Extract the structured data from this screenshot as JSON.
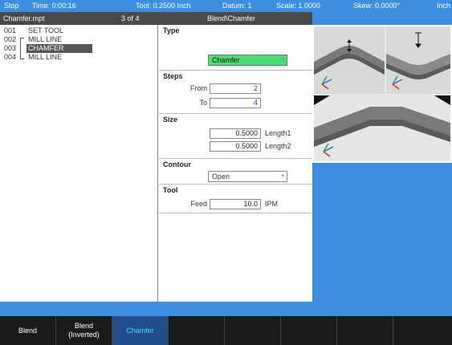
{
  "status_bar": {
    "mode": "Stop",
    "time": "Time: 0:00:16",
    "tool": "Tool: 0.2500 Inch",
    "datum": "Datum: 1",
    "scale": "Scale: 1.0000",
    "skew": "Skew: 0.0000°",
    "units": "Inch"
  },
  "title_bar": {
    "file": "Chamfer.mpt",
    "position": "3 of 4",
    "operation": "Blend\\Chamfer"
  },
  "program": {
    "rows": [
      {
        "num": "001",
        "name": "SET TOOL"
      },
      {
        "num": "002",
        "name": "MILL LINE"
      },
      {
        "num": "003",
        "name": "CHAMFER"
      },
      {
        "num": "004",
        "name": "MILL LINE"
      }
    ],
    "selected_index": 2
  },
  "form": {
    "type": {
      "title": "Type",
      "value": "Chamfer"
    },
    "steps": {
      "title": "Steps",
      "from_label": "From",
      "from_value": "2",
      "to_label": "To",
      "to_value": "4"
    },
    "size": {
      "title": "Size",
      "length1_value": "0.5000",
      "length1_label": "Length1",
      "length2_value": "0.5000",
      "length2_label": "Length2"
    },
    "contour": {
      "title": "Contour",
      "value": "Open"
    },
    "tool": {
      "title": "Tool",
      "feed_label": "Feed",
      "feed_value": "10.0",
      "feed_unit": "IPM"
    }
  },
  "softkeys": [
    {
      "label": "Blend",
      "active": false
    },
    {
      "label": "Blend\n(Inverted)",
      "active": false
    },
    {
      "label": "Chamfer",
      "active": true
    },
    {
      "label": "",
      "active": false
    },
    {
      "label": "",
      "active": false
    },
    {
      "label": "",
      "active": false
    },
    {
      "label": "",
      "active": false
    },
    {
      "label": "",
      "active": false
    }
  ],
  "colors": {
    "accent_blue": "#3d8ee0",
    "active_green": "#4ddc73",
    "active_key_text": "#49d8ff",
    "field_value_blue": "#1a3fc4"
  },
  "icons": {
    "select_caret": "▾",
    "axis_triad": "xyz-axis-icon",
    "dimension_arrow": "dimension-arrow-icon"
  }
}
